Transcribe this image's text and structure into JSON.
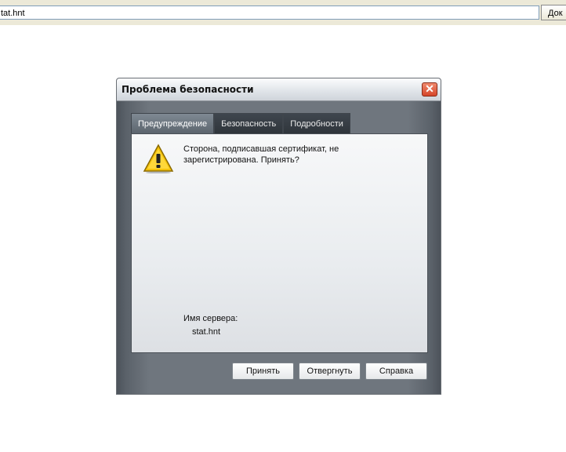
{
  "address_bar": {
    "value": "tat.hnt",
    "button_label": "Док"
  },
  "dialog": {
    "title": "Проблема безопасности",
    "close_glyph": "✕",
    "tabs": [
      {
        "label": "Предупреждение",
        "active": true
      },
      {
        "label": "Безопасность",
        "active": false
      },
      {
        "label": "Подробности",
        "active": false
      }
    ],
    "message": "Сторона, подписавшая сертификат, не зарегистрирована. Принять?",
    "server_label": "Имя сервера:",
    "server_value": "stat.hnt",
    "buttons": {
      "accept": "Принять",
      "reject": "Отвергнуть",
      "help": "Справка"
    },
    "icon": "warning-icon",
    "colors": {
      "warning_fill": "#f5c20a",
      "close_red": "#d5462a"
    }
  }
}
